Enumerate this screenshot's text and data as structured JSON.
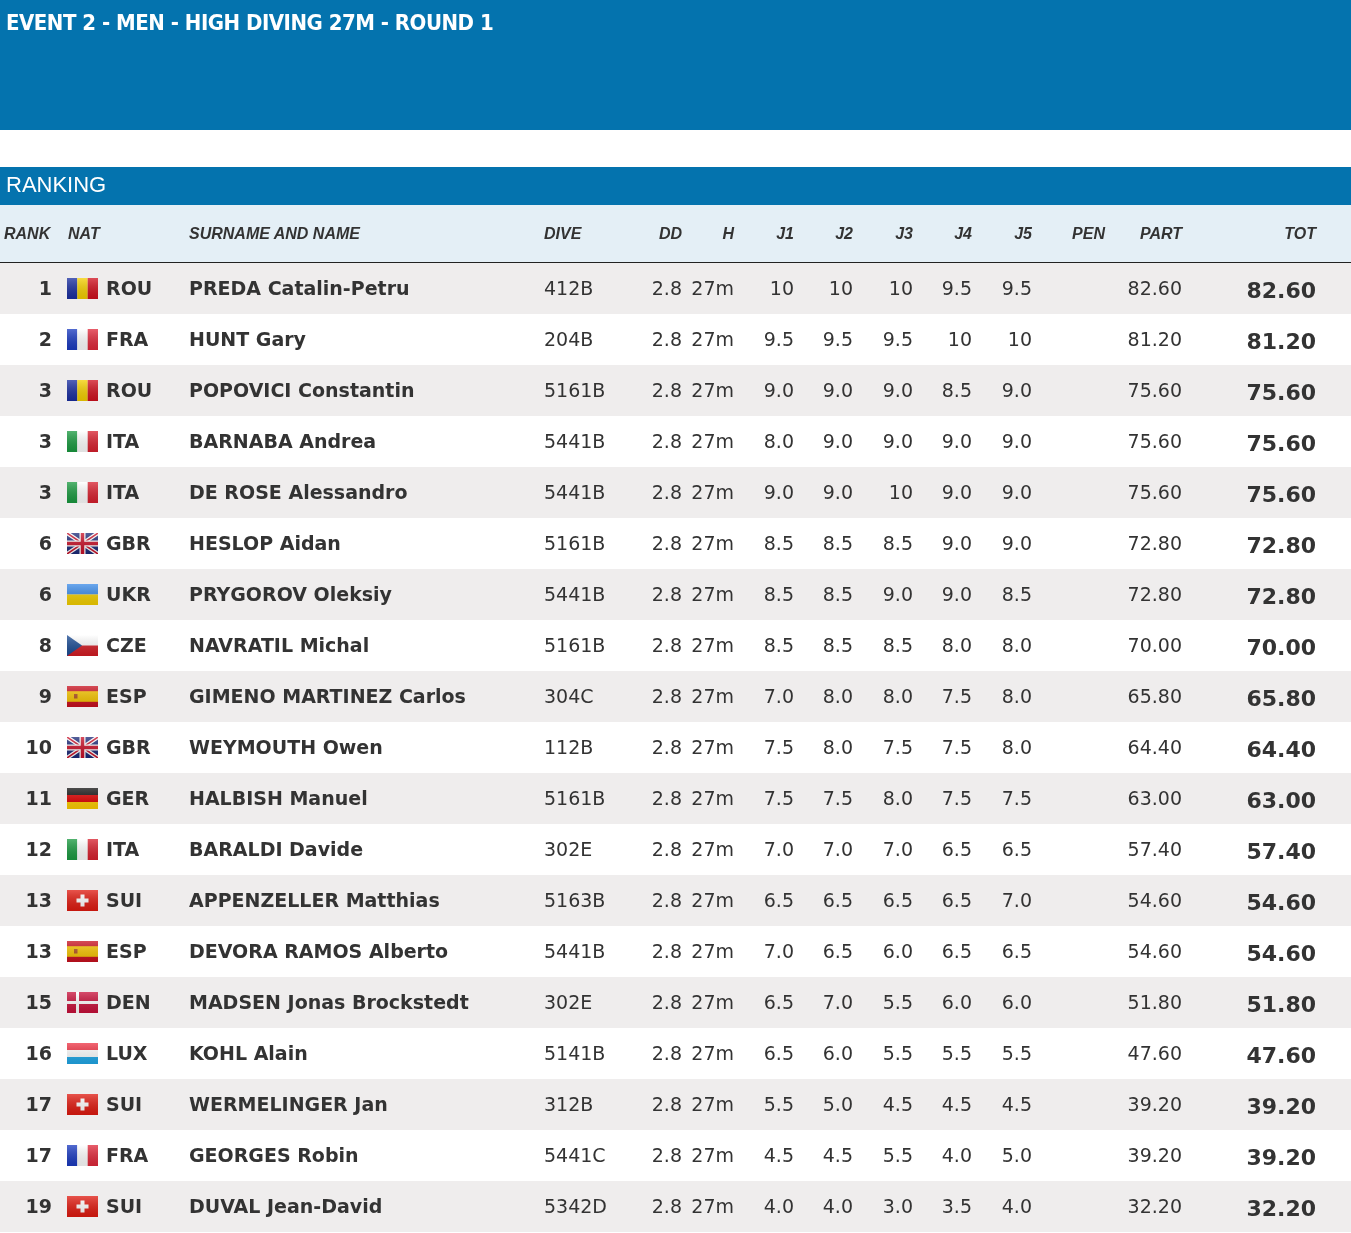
{
  "title": "EVENT 2 - MEN - HIGH DIVING 27M - ROUND 1",
  "section": "RANKING",
  "columns": [
    "RANK",
    "NAT",
    "SURNAME AND NAME",
    "DIVE",
    "DD",
    "H",
    "J1",
    "J2",
    "J3",
    "J4",
    "J5",
    "PEN",
    "PART",
    "TOT"
  ],
  "rows": [
    {
      "rank": "1",
      "kind": "romania",
      "nat": "ROU",
      "name": "PREDA Catalin-Petru",
      "dive": "412B",
      "dd": "2.8",
      "h": "27m",
      "judges": [
        "10",
        "10",
        "10",
        "9.5",
        "9.5"
      ],
      "part": "82.60",
      "tot": "82.60"
    },
    {
      "rank": "2",
      "kind": "france",
      "nat": "FRA",
      "name": "HUNT Gary",
      "dive": "204B",
      "dd": "2.8",
      "h": "27m",
      "judges": [
        "9.5",
        "9.5",
        "9.5",
        "10",
        "10"
      ],
      "part": "81.20",
      "tot": "81.20"
    },
    {
      "rank": "3",
      "kind": "romania",
      "nat": "ROU",
      "name": "POPOVICI Constantin",
      "dive": "5161B",
      "dd": "2.8",
      "h": "27m",
      "judges": [
        "9.0",
        "9.0",
        "9.0",
        "8.5",
        "9.0"
      ],
      "part": "75.60",
      "tot": "75.60"
    },
    {
      "rank": "3",
      "kind": "italy",
      "nat": "ITA",
      "name": "BARNABA Andrea",
      "dive": "5441B",
      "dd": "2.8",
      "h": "27m",
      "judges": [
        "8.0",
        "9.0",
        "9.0",
        "9.0",
        "9.0"
      ],
      "part": "75.60",
      "tot": "75.60"
    },
    {
      "rank": "3",
      "kind": "italy",
      "nat": "ITA",
      "name": "DE ROSE Alessandro",
      "dive": "5441B",
      "dd": "2.8",
      "h": "27m",
      "judges": [
        "9.0",
        "9.0",
        "10",
        "9.0",
        "9.0"
      ],
      "part": "75.60",
      "tot": "75.60"
    },
    {
      "rank": "6",
      "kind": "uk",
      "nat": "GBR",
      "name": "HESLOP Aidan",
      "dive": "5161B",
      "dd": "2.8",
      "h": "27m",
      "judges": [
        "8.5",
        "8.5",
        "8.5",
        "9.0",
        "9.0"
      ],
      "part": "72.80",
      "tot": "72.80"
    },
    {
      "rank": "6",
      "kind": "ukraine",
      "nat": "UKR",
      "name": "PRYGOROV Oleksiy",
      "dive": "5441B",
      "dd": "2.8",
      "h": "27m",
      "judges": [
        "8.5",
        "8.5",
        "9.0",
        "9.0",
        "8.5"
      ],
      "part": "72.80",
      "tot": "72.80"
    },
    {
      "rank": "8",
      "kind": "czech",
      "nat": "CZE",
      "name": "NAVRATIL Michal",
      "dive": "5161B",
      "dd": "2.8",
      "h": "27m",
      "judges": [
        "8.5",
        "8.5",
        "8.5",
        "8.0",
        "8.0"
      ],
      "part": "70.00",
      "tot": "70.00"
    },
    {
      "rank": "9",
      "kind": "spain",
      "nat": "ESP",
      "name": "GIMENO MARTINEZ Carlos",
      "dive": "304C",
      "dd": "2.8",
      "h": "27m",
      "judges": [
        "7.0",
        "8.0",
        "8.0",
        "7.5",
        "8.0"
      ],
      "part": "65.80",
      "tot": "65.80"
    },
    {
      "rank": "10",
      "kind": "uk",
      "nat": "GBR",
      "name": "WEYMOUTH Owen",
      "dive": "112B",
      "dd": "2.8",
      "h": "27m",
      "judges": [
        "7.5",
        "8.0",
        "7.5",
        "7.5",
        "8.0"
      ],
      "part": "64.40",
      "tot": "64.40"
    },
    {
      "rank": "11",
      "kind": "germany",
      "nat": "GER",
      "name": "HALBISH Manuel",
      "dive": "5161B",
      "dd": "2.8",
      "h": "27m",
      "judges": [
        "7.5",
        "7.5",
        "8.0",
        "7.5",
        "7.5"
      ],
      "part": "63.00",
      "tot": "63.00"
    },
    {
      "rank": "12",
      "kind": "italy",
      "nat": "ITA",
      "name": "BARALDI Davide",
      "dive": "302E",
      "dd": "2.8",
      "h": "27m",
      "judges": [
        "7.0",
        "7.0",
        "7.0",
        "6.5",
        "6.5"
      ],
      "part": "57.40",
      "tot": "57.40"
    },
    {
      "rank": "13",
      "kind": "switzerland",
      "nat": "SUI",
      "name": "APPENZELLER Matthias",
      "dive": "5163B",
      "dd": "2.8",
      "h": "27m",
      "judges": [
        "6.5",
        "6.5",
        "6.5",
        "6.5",
        "7.0"
      ],
      "part": "54.60",
      "tot": "54.60"
    },
    {
      "rank": "13",
      "kind": "spain",
      "nat": "ESP",
      "name": "DEVORA RAMOS Alberto",
      "dive": "5441B",
      "dd": "2.8",
      "h": "27m",
      "judges": [
        "7.0",
        "6.5",
        "6.0",
        "6.5",
        "6.5"
      ],
      "part": "54.60",
      "tot": "54.60"
    },
    {
      "rank": "15",
      "kind": "denmark",
      "nat": "DEN",
      "name": "MADSEN Jonas Brockstedt",
      "dive": "302E",
      "dd": "2.8",
      "h": "27m",
      "judges": [
        "6.5",
        "7.0",
        "5.5",
        "6.0",
        "6.0"
      ],
      "part": "51.80",
      "tot": "51.80"
    },
    {
      "rank": "16",
      "kind": "luxembourg",
      "nat": "LUX",
      "name": "KOHL Alain",
      "dive": "5141B",
      "dd": "2.8",
      "h": "27m",
      "judges": [
        "6.5",
        "6.0",
        "5.5",
        "5.5",
        "5.5"
      ],
      "part": "47.60",
      "tot": "47.60"
    },
    {
      "rank": "17",
      "kind": "switzerland",
      "nat": "SUI",
      "name": "WERMELINGER Jan",
      "dive": "312B",
      "dd": "2.8",
      "h": "27m",
      "judges": [
        "5.5",
        "5.0",
        "4.5",
        "4.5",
        "4.5"
      ],
      "part": "39.20",
      "tot": "39.20"
    },
    {
      "rank": "17",
      "kind": "france",
      "nat": "FRA",
      "name": "GEORGES Robin",
      "dive": "5441C",
      "dd": "2.8",
      "h": "27m",
      "judges": [
        "4.5",
        "4.5",
        "5.5",
        "4.0",
        "5.0"
      ],
      "part": "39.20",
      "tot": "39.20"
    },
    {
      "rank": "19",
      "kind": "switzerland",
      "nat": "SUI",
      "name": "DUVAL Jean-David",
      "dive": "5342D",
      "dd": "2.8",
      "h": "27m",
      "judges": [
        "4.0",
        "4.0",
        "3.0",
        "3.5",
        "4.0"
      ],
      "part": "32.20",
      "tot": "32.20"
    }
  ]
}
